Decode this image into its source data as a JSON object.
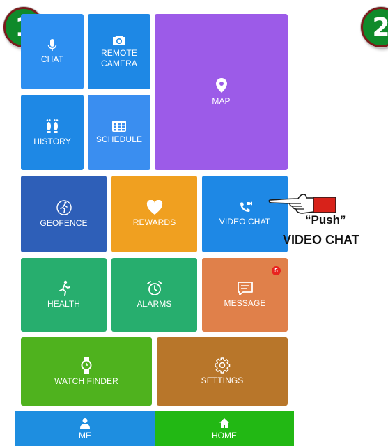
{
  "step_badges": {
    "primary": "1",
    "next": "2"
  },
  "tiles": {
    "chat": {
      "label": "CHAT",
      "icon": "microphone-icon",
      "color": "#2d8ff0"
    },
    "remote_camera": {
      "label": "REMOTE\nCAMERA",
      "icon": "camera-icon",
      "color": "#1e88e5"
    },
    "map": {
      "label": "MAP",
      "icon": "map-pin-icon",
      "color": "#9c5be8"
    },
    "history": {
      "label": "HISTORY",
      "icon": "footprints-icon",
      "color": "#1e88e5"
    },
    "schedule": {
      "label": "SCHEDULE",
      "icon": "calendar-grid-icon",
      "color": "#3a8ef0"
    },
    "geofence": {
      "label": "GEOFENCE",
      "icon": "geofence-runner-icon",
      "color": "#2e5fb8"
    },
    "rewards": {
      "label": "REWARDS",
      "icon": "heart-icon",
      "color": "#f0a020"
    },
    "video_chat": {
      "label": "VIDEO CHAT",
      "icon": "video-phone-icon",
      "color": "#1e88e5"
    },
    "health": {
      "label": "HEALTH",
      "icon": "runner-icon",
      "color": "#27ae6e"
    },
    "alarms": {
      "label": "ALARMS",
      "icon": "alarm-clock-icon",
      "color": "#27ae6e"
    },
    "message": {
      "label": "MESSAGE",
      "icon": "message-icon",
      "color": "#e0804a",
      "badge": "5"
    },
    "watch_finder": {
      "label": "WATCH FINDER",
      "icon": "watch-icon",
      "color": "#4fb21e"
    },
    "settings": {
      "label": "SETTINGS",
      "icon": "gear-icon",
      "color": "#b8762a"
    }
  },
  "bottom_nav": {
    "me": {
      "label": "ME",
      "icon": "person-icon",
      "color": "#1e8ee0"
    },
    "home": {
      "label": "HOME",
      "icon": "home-icon",
      "color": "#22b814"
    }
  },
  "annotation": {
    "push_text": "“Push”",
    "target_text": "VIDEO CHAT",
    "pointer": "pointing-hand-icon"
  }
}
